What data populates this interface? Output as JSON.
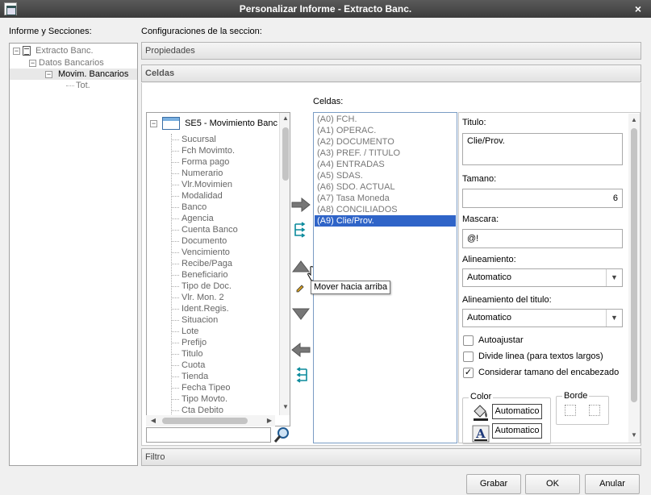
{
  "window": {
    "title": "Personalizar Informe - Extracto Banc.",
    "close_glyph": "×"
  },
  "left_panel": {
    "label": "Informe y Secciones:",
    "tree": [
      {
        "label": "Extracto Banc.",
        "level": 0,
        "selected": false
      },
      {
        "label": "Datos Bancarios",
        "level": 1,
        "selected": false
      },
      {
        "label": "Movim. Bancarios",
        "level": 2,
        "selected": true
      },
      {
        "label": "Tot.",
        "level": 3,
        "selected": false
      }
    ]
  },
  "config_label": "Configuraciones de la seccion:",
  "sections": {
    "propiedades": "Propiedades",
    "celdas": "Celdas",
    "filtro": "Filtro"
  },
  "fields_tree": {
    "root_label": "SE5 - Movimiento Banc",
    "items": [
      "Sucursal",
      "Fch Movimto.",
      "Forma pago",
      "Numerario",
      "Vlr.Movimien",
      "Modalidad",
      "Banco",
      "Agencia",
      "Cuenta Banco",
      "Documento",
      "Vencimiento",
      "Recibe/Paga",
      "Beneficiario",
      "Tipo de Doc.",
      "Vlr. Mon. 2",
      "Ident.Regis.",
      "Situacion",
      "Lote",
      "Prefijo",
      "Titulo",
      "Cuota",
      "Tienda",
      "Fecha Tipeo",
      "Tipo Movto.",
      "Cta Debito"
    ]
  },
  "celdas_label": "Celdas:",
  "celdas_list": [
    "(A0) FCH.",
    "(A1) OPERAC.",
    "(A2) DOCUMENTO",
    "(A3) PREF. / TITULO",
    "(A4) ENTRADAS",
    "(A5) SDAS.",
    "(A6) SDO. ACTUAL",
    "(A7) Tasa Moneda",
    "(A8) CONCILIADOS",
    "(A9) Clie/Prov."
  ],
  "celdas_selected_index": 9,
  "tooltip": "Mover hacia arriba",
  "props": {
    "titulo_label": "Titulo:",
    "titulo_value": "Clie/Prov.",
    "tamano_label": "Tamano:",
    "tamano_value": "6",
    "mascara_label": "Mascara:",
    "mascara_value": "@!",
    "alineamiento_label": "Alineamiento:",
    "alineamiento_value": "Automatico",
    "alin_titulo_label": "Alineamiento del titulo:",
    "alin_titulo_value": "Automatico",
    "checkboxes": [
      {
        "label": "Autoajustar",
        "checked": false
      },
      {
        "label": "Divide linea (para textos largos)",
        "checked": false
      },
      {
        "label": "Considerar tamano del encabezado",
        "checked": true
      }
    ],
    "color_label": "Color",
    "color_fill_value": "Automatico",
    "color_text_value": "Automatico",
    "borde_label": "Borde"
  },
  "buttons": {
    "grabar": "Grabar",
    "ok": "OK",
    "anular": "Anular"
  },
  "colors": {
    "selection": "#2f64c8",
    "titlebar": "#4a4a4a"
  }
}
